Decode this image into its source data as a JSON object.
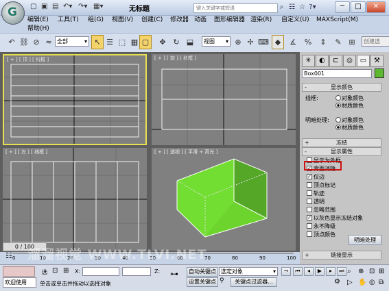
{
  "title_bar": {
    "title": "无标题",
    "search_placeholder": "键入关键字或短语",
    "min": "─",
    "max": "□",
    "close": "✕"
  },
  "menu": [
    "编辑(E)",
    "工具(T)",
    "组(G)",
    "视图(V)",
    "创建(C)",
    "修改器",
    "动画",
    "图形编辑器",
    "渲染(R)",
    "自定义(U)",
    "MAXScript(M)",
    "帮助(H)"
  ],
  "toolbar": {
    "selection_filter": "全部",
    "ref_coord": "视图",
    "create_selection": "创建选"
  },
  "viewports": {
    "top": "[ + ] [ 顶 ] [ 线框 ]",
    "front": "[ + ] [ 前 ] [ 线框 ]",
    "left": "[ + ] [ 左 ] [ 线框 ]",
    "persp": "[ + ] [ 透视 ] [ 平滑 + 高光 ]"
  },
  "command_panel": {
    "object_name": "Box001",
    "object_color": "#5cb82e",
    "rollout_display_color": "显示颜色",
    "wireframe_label": "线框:",
    "shaded_label": "明暗处理:",
    "option_object_color": "对象颜色",
    "option_material_color": "材质颜色",
    "rollout_freeze": "冻结",
    "rollout_display_props": "显示属性",
    "props": [
      {
        "label": "显示为外框",
        "checked": false
      },
      {
        "label": "背面消隐",
        "checked": true
      },
      {
        "label": "仅边",
        "checked": true
      },
      {
        "label": "顶点标记",
        "checked": false
      },
      {
        "label": "轨迹",
        "checked": false
      },
      {
        "label": "透明",
        "checked": false
      },
      {
        "label": "忽略范围",
        "checked": false
      },
      {
        "label": "以灰色显示冻结对象",
        "checked": true
      },
      {
        "label": "永不降级",
        "checked": false
      },
      {
        "label": "顶点颜色",
        "checked": false
      }
    ],
    "shaded_button": "明暗处理",
    "rollout_link": "链接显示"
  },
  "timeline": {
    "frame": "0 / 100",
    "ticks": [
      "0",
      "10",
      "20",
      "30",
      "40",
      "50",
      "60",
      "70",
      "80",
      "90",
      "100"
    ]
  },
  "status": {
    "welcome": "欢迎使用",
    "prompt": "单击或单击并拖动以选择对象",
    "selected_label": "选",
    "x_label": "X:",
    "z_label": "Z:",
    "auto_key": "自动关键点",
    "set_key": "设置关键点",
    "selected_object": "选定对象",
    "key_filter": "关键点过滤器..."
  },
  "watermark": "溜溜视觉 WWW.TLVI.NET",
  "colors": {
    "accent": "#f4d36a",
    "highlight_red": "#cc1111",
    "viewport_bg": "#808080",
    "active_border": "#e8e050"
  }
}
